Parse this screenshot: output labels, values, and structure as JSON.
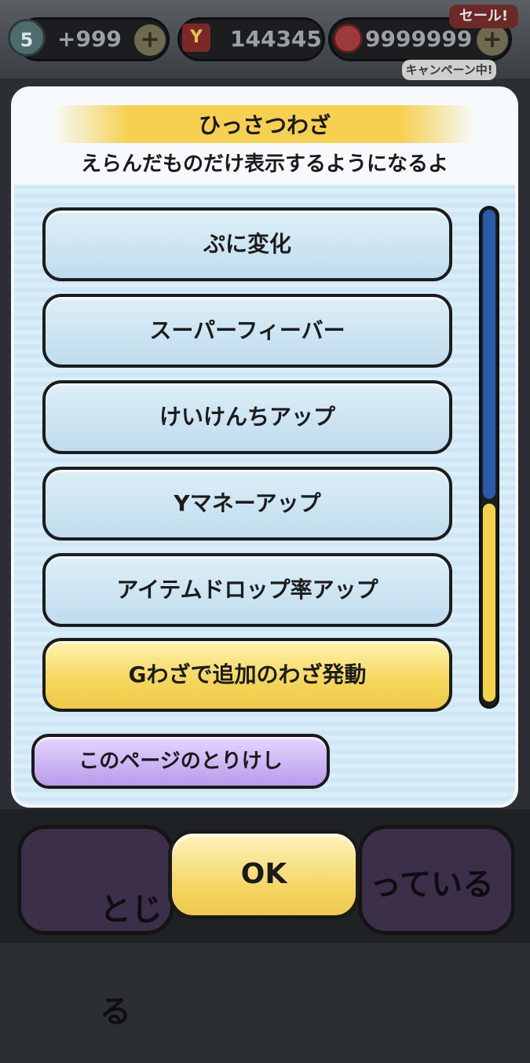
{
  "topbar": {
    "stamina_level": "5",
    "stamina_value": "+999",
    "tickets_value": "144345",
    "coins_value": "9999999",
    "plus_label": "+",
    "sale_label": "セール!",
    "campaign_label": "キャンペーン中!"
  },
  "modal": {
    "title": "ひっさつわざ",
    "subtitle": "えらんだものだけ表示するようになるよ",
    "options": [
      {
        "label": "ぷに変化",
        "selected": false
      },
      {
        "label": "スーパーフィーバー",
        "selected": false
      },
      {
        "label": "けいけんちアップ",
        "selected": false
      },
      {
        "label": "Yマネーアップ",
        "selected": false
      },
      {
        "label": "アイテムドロップ率アップ",
        "selected": false
      },
      {
        "label": "Gわざで追加のわざ発動",
        "selected": true
      }
    ],
    "scroll_position": 0.6,
    "clear_label": "このページのとりけし"
  },
  "footer": {
    "ok_label": "OK",
    "behind_left_label": "とじる",
    "behind_right_label": "っている"
  },
  "colors": {
    "selected_option": "#f5d659",
    "option_default": "#cbe4f2",
    "clear_button": "#b79bea",
    "scroll_blue": "#2a5aa8",
    "scroll_yellow": "#f4d24a"
  }
}
